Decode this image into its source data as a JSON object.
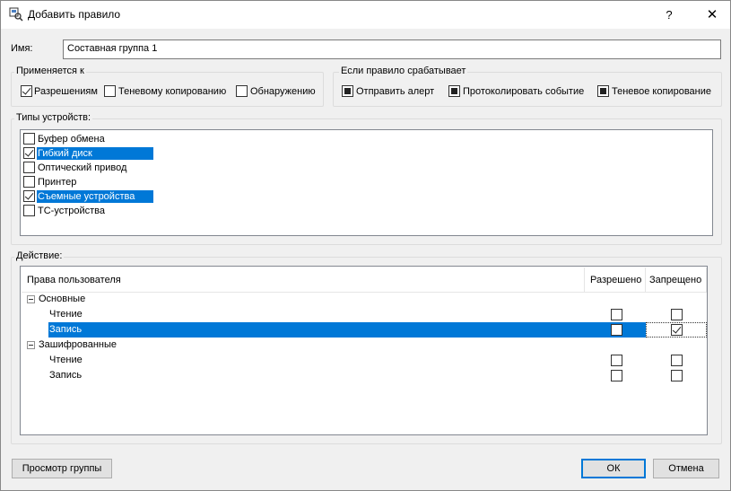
{
  "window": {
    "title": "Добавить правило",
    "help_label": "?",
    "close_label": "✕"
  },
  "name": {
    "label": "Имя:",
    "value": "Составная группа 1"
  },
  "applies_to": {
    "label": "Применяется к",
    "options": [
      {
        "label": "Разрешениям",
        "checked": true
      },
      {
        "label": "Теневому копированию",
        "checked": false
      },
      {
        "label": "Обнаружению",
        "checked": false
      }
    ]
  },
  "on_trigger": {
    "label": "Если правило срабатывает",
    "options": [
      {
        "label": "Отправить алерт",
        "state": "indeterminate"
      },
      {
        "label": "Протоколировать событие",
        "state": "indeterminate"
      },
      {
        "label": "Теневое копирование",
        "state": "indeterminate"
      }
    ]
  },
  "device_types": {
    "label": "Типы устройств:",
    "items": [
      {
        "label": "Буфер обмена",
        "checked": false,
        "selected": false
      },
      {
        "label": "Гибкий диск",
        "checked": true,
        "selected": true
      },
      {
        "label": "Оптический привод",
        "checked": false,
        "selected": false
      },
      {
        "label": "Принтер",
        "checked": false,
        "selected": false
      },
      {
        "label": "Съемные устройства",
        "checked": true,
        "selected": true
      },
      {
        "label": "TC-устройства",
        "checked": false,
        "selected": false
      }
    ]
  },
  "action": {
    "label": "Действие:",
    "columns": {
      "rights": "Права пользователя",
      "allowed": "Разрешено",
      "denied": "Запрещено"
    },
    "groups": [
      {
        "label": "Основные",
        "rows": [
          {
            "label": "Чтение",
            "allowed": false,
            "denied": false
          },
          {
            "label": "Запись",
            "allowed": false,
            "denied": true
          }
        ]
      },
      {
        "label": "Зашифрованные",
        "rows": [
          {
            "label": "Чтение",
            "allowed": false,
            "denied": false
          },
          {
            "label": "Запись",
            "allowed": false,
            "denied": false
          }
        ]
      }
    ]
  },
  "buttons": {
    "view_group": "Просмотр группы",
    "ok": "ОК",
    "cancel": "Отмена"
  },
  "colors": {
    "selection": "#0078d7",
    "dialog_bg": "#f0f0f0"
  }
}
